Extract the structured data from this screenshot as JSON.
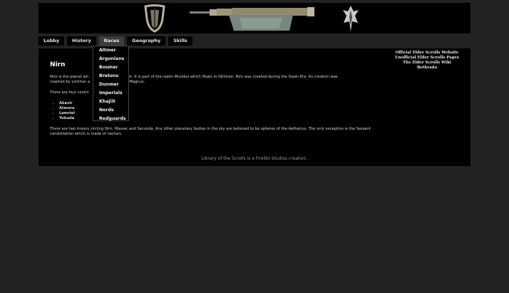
{
  "nav": {
    "tabs": [
      "Lobby",
      "History",
      "Races",
      "Geography",
      "Skills"
    ],
    "active_tab": "Races"
  },
  "races_menu": [
    "Altmer",
    "Argonians",
    "Bosmer",
    "Bretons",
    "Dunmer",
    "Imperials",
    "Khajiit",
    "Nords",
    "Redguards"
  ],
  "content": {
    "title": "Nirn",
    "para1_start": "Nirn is the planet wh",
    "para1_mid": "is set. It is part of the realm Mundus which floats in Oblivion. Nirn was created during the Dawn Era. Its creation was",
    "para1_line2_start": "inspired by Lorkhan a",
    "para1_line2_end": "by Magnus.",
    "para2": "There are four contin",
    "regions": [
      "Akavir",
      "Atmora",
      "Lamriel",
      "Yokuda"
    ],
    "para3": "There are two moons circling Nirn, Masser and Secunda. Any other planetary bodies in the sky are believed to be spheres of the Aetherius. The only exception is the Serpent constellation which is made of nectars."
  },
  "side_links": [
    "Official Elder Scrolls Website",
    "Unofficial Elder Scrolls Pages",
    "The Elder Scrolls Wiki",
    "Bethesda"
  ],
  "footer": "Library of the Scrolls is a Firelite Studios creation.",
  "colors": {
    "page_bg": "#222222",
    "panel_bg": "#000000",
    "active_tab": "#3c3c3c"
  },
  "icons": [
    "oblivion-emblem-icon",
    "sword-icon",
    "skyrim-dragon-emblem-icon"
  ]
}
